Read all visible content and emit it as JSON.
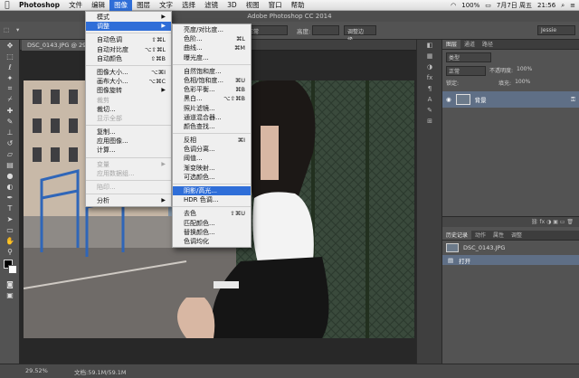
{
  "menubar": {
    "app": "Photoshop",
    "items": [
      "文件",
      "编辑",
      "图像",
      "图层",
      "文字",
      "选择",
      "滤镜",
      "3D",
      "视图",
      "窗口",
      "帮助"
    ],
    "status": {
      "battery": "100%",
      "date": "7月7日 周五",
      "time": "21:56"
    }
  },
  "window_title": "Adobe Photoshop CC 2014",
  "options": {
    "mode_label": "正常",
    "height_label": "高度:",
    "refine_button": "调整边缘...",
    "workspace": "Jessie"
  },
  "document": {
    "tab": "DSC_0143.JPG @ 29.5%..."
  },
  "image_menu": [
    {
      "label": "模式",
      "arrow": true,
      "group": 0
    },
    {
      "label": "调整",
      "arrow": true,
      "hl": true,
      "group": 0
    },
    {
      "label": "自动色调",
      "sc": "⇧⌘L",
      "group": 1
    },
    {
      "label": "自动对比度",
      "sc": "⌥⇧⌘L",
      "group": 1
    },
    {
      "label": "自动颜色",
      "sc": "⇧⌘B",
      "group": 1
    },
    {
      "label": "图像大小...",
      "sc": "⌥⌘I",
      "group": 2
    },
    {
      "label": "画布大小...",
      "sc": "⌥⌘C",
      "group": 2
    },
    {
      "label": "图像旋转",
      "arrow": true,
      "group": 2
    },
    {
      "label": "裁剪",
      "dis": true,
      "group": 2
    },
    {
      "label": "裁切...",
      "group": 2
    },
    {
      "label": "显示全部",
      "dis": true,
      "group": 2
    },
    {
      "label": "复制...",
      "group": 3
    },
    {
      "label": "应用图像...",
      "group": 3
    },
    {
      "label": "计算...",
      "group": 3
    },
    {
      "label": "变量",
      "arrow": true,
      "dis": true,
      "group": 4
    },
    {
      "label": "应用数据组...",
      "dis": true,
      "group": 4
    },
    {
      "label": "陷印...",
      "dis": true,
      "group": 5
    },
    {
      "label": "分析",
      "arrow": true,
      "group": 6
    }
  ],
  "adjust_menu": [
    {
      "label": "亮度/对比度...",
      "group": 0
    },
    {
      "label": "色阶...",
      "sc": "⌘L",
      "group": 0
    },
    {
      "label": "曲线...",
      "sc": "⌘M",
      "group": 0
    },
    {
      "label": "曝光度...",
      "group": 0
    },
    {
      "label": "自然饱和度...",
      "group": 1
    },
    {
      "label": "色相/饱和度...",
      "sc": "⌘U",
      "group": 1
    },
    {
      "label": "色彩平衡...",
      "sc": "⌘B",
      "group": 1
    },
    {
      "label": "黑白...",
      "sc": "⌥⇧⌘B",
      "group": 1
    },
    {
      "label": "照片滤镜...",
      "group": 1
    },
    {
      "label": "通道混合器...",
      "group": 1
    },
    {
      "label": "颜色查找...",
      "group": 1
    },
    {
      "label": "反相",
      "sc": "⌘I",
      "group": 2
    },
    {
      "label": "色调分离...",
      "group": 2
    },
    {
      "label": "阈值...",
      "group": 2
    },
    {
      "label": "渐变映射...",
      "group": 2
    },
    {
      "label": "可选颜色...",
      "group": 2
    },
    {
      "label": "阴影/高光...",
      "hl": true,
      "group": 3
    },
    {
      "label": "HDR 色调...",
      "group": 3
    },
    {
      "label": "去色",
      "sc": "⇧⌘U",
      "group": 4
    },
    {
      "label": "匹配颜色...",
      "group": 4
    },
    {
      "label": "替换颜色...",
      "group": 4
    },
    {
      "label": "色调均化",
      "group": 4
    }
  ],
  "layers_panel": {
    "tabs": [
      "图层",
      "通道",
      "路径"
    ],
    "kind": "类型",
    "blend": "正常",
    "opacity_label": "不透明度:",
    "opacity": "100%",
    "lock_label": "锁定:",
    "fill_label": "填充:",
    "fill": "100%",
    "layer_name": "背景"
  },
  "history_panel": {
    "tabs": [
      "历史记录",
      "动作",
      "属性",
      "调整"
    ],
    "snapshot": "DSC_0143.JPG",
    "items": [
      "打开"
    ]
  },
  "status": {
    "zoom": "29.52%",
    "doc": "文档:59.1M/59.1M"
  }
}
